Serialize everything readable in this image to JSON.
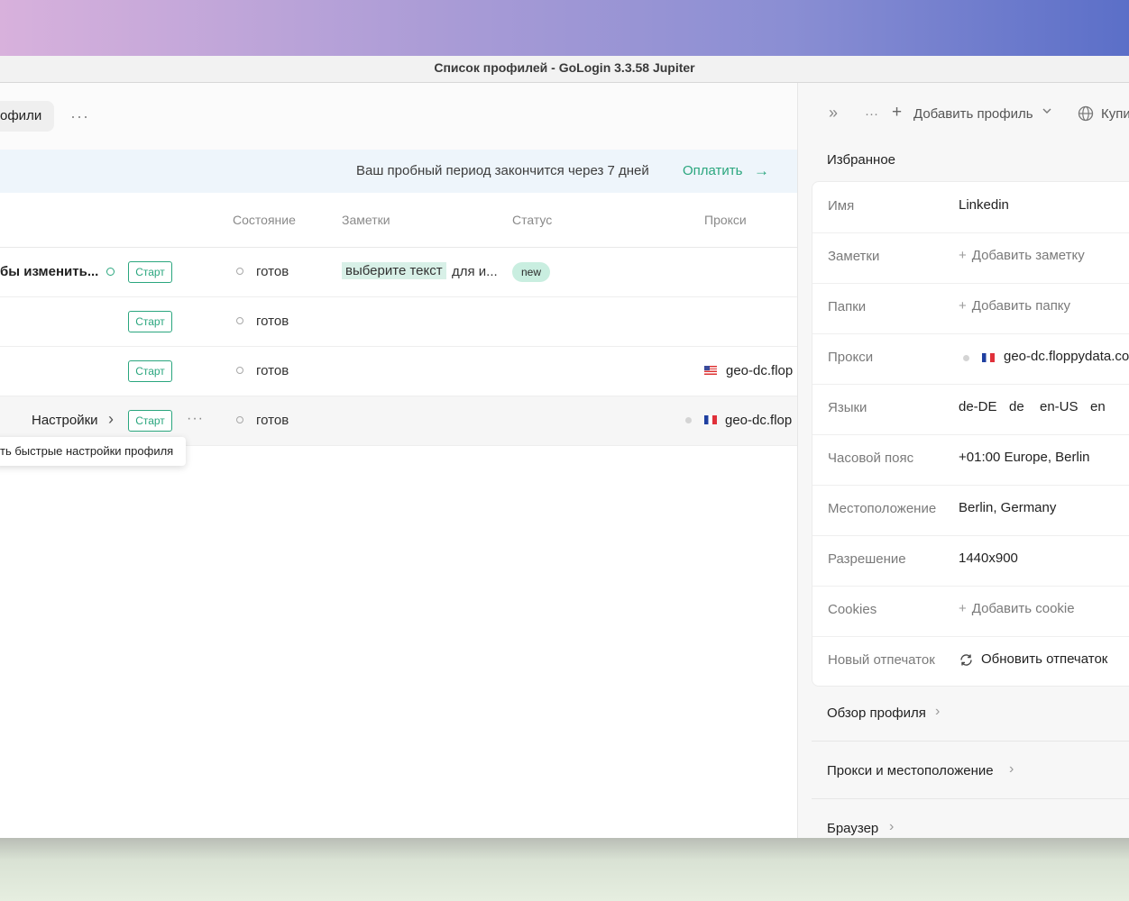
{
  "window": {
    "title": "Список профилей - GoLogin 3.3.58 Jupiter"
  },
  "toolbar": {
    "profiles_tab": "офили",
    "more": "···"
  },
  "banner": {
    "text": "Ваш пробный период закончится через 7 дней",
    "pay": "Оплатить",
    "arrow": "→"
  },
  "table": {
    "headers": [
      "Состояние",
      "Заметки",
      "Статус",
      "Прокси"
    ],
    "start_label": "Старт",
    "rows": [
      {
        "name": "бы изменить...",
        "state": "готов",
        "note_highlight": "выберите текст",
        "note_rest": "для и...",
        "status": "new",
        "proxy": ""
      },
      {
        "name": "",
        "state": "готов",
        "proxy": ""
      },
      {
        "name": "",
        "state": "готов",
        "proxy": "geo-dc.flop",
        "flag": "us-flag"
      },
      {
        "name": "",
        "state": "готов",
        "proxy": "geo-dc.flop",
        "flag": "fr-flag",
        "settings": "Настройки",
        "chevron": "›",
        "dots": "···"
      }
    ],
    "tooltip": "ть быстрые настройки профиля"
  },
  "panel": {
    "collapse_icon": "»",
    "more": "···",
    "add_profile": "Добавить профиль",
    "buy": "Купи",
    "favorites_title": "Избранное",
    "fields": {
      "name_label": "Имя",
      "name_value": "Linkedin",
      "notes_label": "Заметки",
      "notes_add": "Добавить заметку",
      "folders_label": "Папки",
      "folders_add": "Добавить папку",
      "proxy_label": "Прокси",
      "proxy_value": "geo-dc.floppydata.co",
      "languages_label": "Языки",
      "languages": [
        "de-DE",
        "de",
        "en-US",
        "en"
      ],
      "timezone_label": "Часовой пояс",
      "timezone_value": "+01:00 Europe, Berlin",
      "location_label": "Местоположение",
      "location_value": "Berlin, Germany",
      "resolution_label": "Разрешение",
      "resolution_value": "1440x900",
      "cookies_label": "Cookies",
      "cookies_add": "Добавить cookie",
      "fingerprint_label": "Новый отпечаток",
      "fingerprint_action": "Обновить отпечаток"
    },
    "sections": [
      "Обзор профиля",
      "Прокси и местоположение",
      "Браузер"
    ]
  },
  "colors": {
    "accent": "#2aa67e",
    "banner_bg": "#eef5fb",
    "badge_bg": "#c9eee0"
  }
}
